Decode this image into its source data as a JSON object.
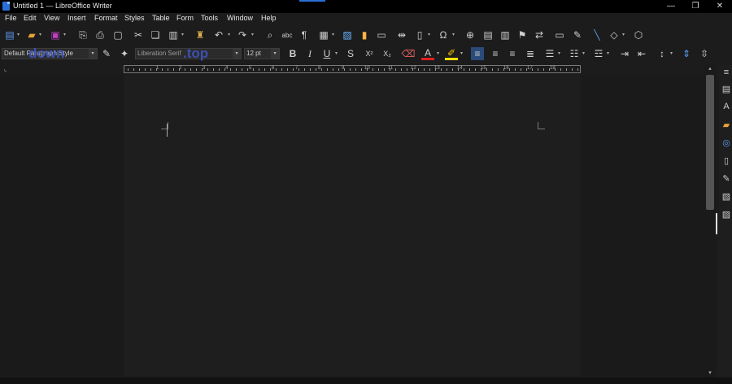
{
  "window": {
    "title": "Untitled 1 — LibreOffice Writer",
    "controls": [
      "—",
      "❐",
      "✕"
    ]
  },
  "menubar": {
    "items": [
      "File",
      "Edit",
      "View",
      "Insert",
      "Format",
      "Styles",
      "Table",
      "Form",
      "Tools",
      "Window",
      "Help"
    ]
  },
  "toolbar_standard": {
    "icons": [
      "new-document-icon",
      "open-folder-icon",
      "save-icon",
      "export-icon",
      "print-icon",
      "print-preview-icon",
      "cut-icon",
      "copy-icon",
      "paste-icon",
      "clone-formatting-icon",
      "undo-icon",
      "redo-icon",
      "find-replace-icon",
      "spelling-icon",
      "formatting-marks-icon",
      "table-icon",
      "image-icon",
      "chart-icon",
      "textbox-icon",
      "page-break-icon",
      "field-icon",
      "special-character-icon",
      "hyperlink-icon",
      "footnote-icon",
      "endnote-icon",
      "bookmark-icon",
      "cross-reference-icon",
      "comment-icon",
      "track-changes-icon",
      "line-icon",
      "shapes-icon",
      "draw-icon"
    ]
  },
  "toolbar_formatting": {
    "paragraph_style": "Default Paragraph Style",
    "font_name": "Liberation Serif",
    "font_size": "12 pt",
    "buttons": [
      "B",
      "I",
      "U",
      "S",
      "X²",
      "X₂"
    ]
  },
  "watermark": {
    "text_left": "down",
    "text_right": ".top"
  },
  "ruler": {
    "numbers": [
      "1",
      "2",
      "3",
      "4",
      "5",
      "6",
      "7",
      "8",
      "9",
      "10",
      "11",
      "12",
      "13",
      "14",
      "15",
      "16",
      "17",
      "18"
    ]
  },
  "colors": {
    "background": "#1c1c1c",
    "accent": "#2a6fd6",
    "font_color_underline": "#e02020",
    "highlight_underline": "#f0e000"
  }
}
